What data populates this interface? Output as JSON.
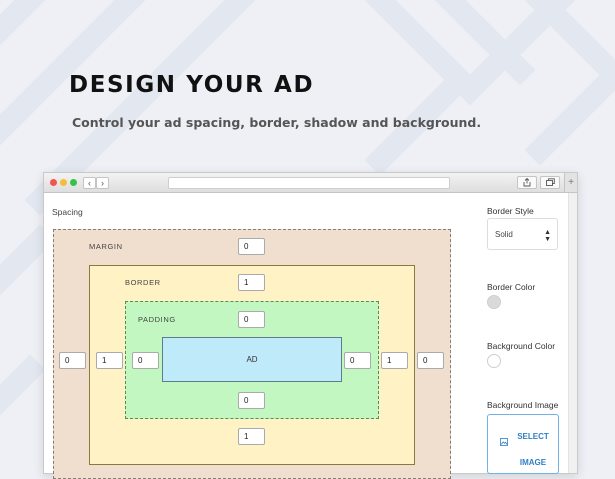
{
  "hero": {
    "title": "DESIGN YOUR AD",
    "subtitle": "Control your ad spacing, border, shadow and background."
  },
  "browser": {
    "nav_back": "‹",
    "nav_forward": "›",
    "new_tab": "+",
    "icons": [
      "share-icon",
      "tabs-icon"
    ]
  },
  "editor": {
    "spacing_label": "Spacing",
    "margin": {
      "label": "MARGIN",
      "top": "0",
      "left": "0",
      "right": "0"
    },
    "border": {
      "label": "BORDER",
      "top": "1",
      "left": "1",
      "right": "1",
      "bottom": "1"
    },
    "padding": {
      "label": "PADDING",
      "top": "0",
      "left": "0",
      "right": "0",
      "bottom": "0"
    },
    "ad_label": "AD",
    "colors": {
      "margin_fill": "#f0dfcf",
      "border_fill": "#fff3c5",
      "padding_fill": "#c3f7c1",
      "ad_fill": "#bfeaf9"
    }
  },
  "sidebar": {
    "border_style_label": "Border Style",
    "border_style_value": "Solid",
    "border_color_label": "Border Color",
    "border_color_value": "#dadada",
    "background_color_label": "Background Color",
    "background_color_value": "#ffffff",
    "background_image_label": "Background Image",
    "select_image_label": "SELECT IMAGE",
    "accent": "#2f7fc5"
  }
}
